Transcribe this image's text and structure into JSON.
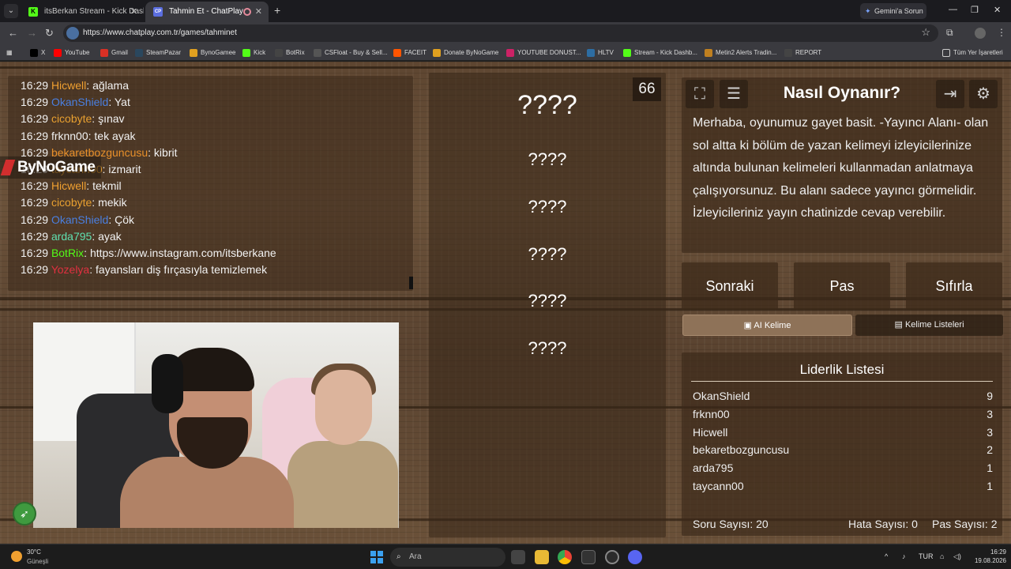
{
  "browser": {
    "tabs": [
      {
        "title": "itsBerkan Stream - Kick Dashbo",
        "favicon": "K",
        "active": false
      },
      {
        "title": "Tahmin Et - ChatPlay",
        "favicon": "CP",
        "active": true
      }
    ],
    "gemini_button": "Gemini'a Sorun",
    "url": "https://www.chatplay.com.tr/games/tahminet",
    "bookmarks": [
      {
        "label": "X",
        "color": "#000000"
      },
      {
        "label": "YouTube",
        "color": "#ff0000"
      },
      {
        "label": "Gmail",
        "color": "#d93025"
      },
      {
        "label": "SteamPazar",
        "color": "#2a475e"
      },
      {
        "label": "BynoGamee",
        "color": "#e0a020"
      },
      {
        "label": "Kick",
        "color": "#53fc18"
      },
      {
        "label": "BotRix",
        "color": "#444444"
      },
      {
        "label": "CSFloat - Buy & Sell...",
        "color": "#555555"
      },
      {
        "label": "FACEIT",
        "color": "#ff5500"
      },
      {
        "label": "Donate ByNoGame",
        "color": "#e0a020"
      },
      {
        "label": "YOUTUBE DONUST...",
        "color": "#cc2266"
      },
      {
        "label": "HLTV",
        "color": "#2d6da3"
      },
      {
        "label": "Stream - Kick Dashb...",
        "color": "#53fc18"
      },
      {
        "label": "Metin2 Alerts Tradin...",
        "color": "#c08020"
      },
      {
        "label": "REPORT",
        "color": "#444444"
      }
    ],
    "all_bookmarks": "Tüm Yer İşaretleri"
  },
  "chat": {
    "messages": [
      {
        "time": "16:29",
        "user": "Hicwell",
        "color": "#f0a030",
        "text": "ağlama"
      },
      {
        "time": "16:29",
        "user": "OkanShield",
        "color": "#4a7fe0",
        "text": "Yat"
      },
      {
        "time": "16:29",
        "user": "cicobyte",
        "color": "#e8a030",
        "text": "şınav"
      },
      {
        "time": "16:29",
        "user": "frknn00",
        "color": "#f2f2f2",
        "text": "tek ayak"
      },
      {
        "time": "16:29",
        "user": "bekaretbozguncusu",
        "color": "#e8902a",
        "text": "kibrit"
      },
      {
        "time": "16:29",
        "user": "taycann00",
        "color": "#e8a030",
        "text": "izmarit"
      },
      {
        "time": "16:29",
        "user": "Hicwell",
        "color": "#f0a030",
        "text": "tekmil"
      },
      {
        "time": "16:29",
        "user": "cicobyte",
        "color": "#e8a030",
        "text": "mekik"
      },
      {
        "time": "16:29",
        "user": "OkanShield",
        "color": "#4a7fe0",
        "text": "Çök"
      },
      {
        "time": "16:29",
        "user": "arda795",
        "color": "#5fe0b0",
        "text": "ayak"
      },
      {
        "time": "16:29",
        "user": "BotRix",
        "color": "#53fc18",
        "text": "https://www.instagram.com/itsberkane"
      },
      {
        "time": "16:29",
        "user": "Yozelya",
        "color": "#e03040",
        "text": "fayansları diş fırçasıyla temizlemek"
      }
    ]
  },
  "overlay": {
    "brand": "ByNoGame"
  },
  "words": {
    "counter": "66",
    "items": [
      "????",
      "????",
      "????",
      "????",
      "????",
      "????"
    ]
  },
  "howto": {
    "title": "Nasıl Oynanır?",
    "text": "Merhaba, oyunumuz gayet basit. -Yayıncı Alanı- olan sol altta ki bölüm de yazan kelimeyi izleyicilerinize altında bulunan kelimeleri kullanmadan anlatmaya çalışıyorsunuz. Bu alanı sadece yayıncı görmelidir. İzleyicileriniz yayın chatinizde cevap verebilir."
  },
  "controls": {
    "next": "Sonraki",
    "pass": "Pas",
    "reset": "Sıfırla",
    "ai_words": "AI Kelime",
    "word_lists": "Kelime Listeleri"
  },
  "leaderboard": {
    "title": "Liderlik Listesi",
    "rows": [
      {
        "name": "OkanShield",
        "score": "9"
      },
      {
        "name": "frknn00",
        "score": "3"
      },
      {
        "name": "Hicwell",
        "score": "3"
      },
      {
        "name": "bekaretbozguncusu",
        "score": "2"
      },
      {
        "name": "arda795",
        "score": "1"
      },
      {
        "name": "taycann00",
        "score": "1"
      }
    ],
    "question_count": "Soru Sayısı: 20",
    "error_count": "Hata Sayısı: 0",
    "pass_count": "Pas Sayısı: 2"
  },
  "taskbar": {
    "temp": "30°C",
    "condition": "Güneşli",
    "search_placeholder": "Ara",
    "lang": "TUR",
    "time": "16:29",
    "date": "19.08.2026"
  }
}
